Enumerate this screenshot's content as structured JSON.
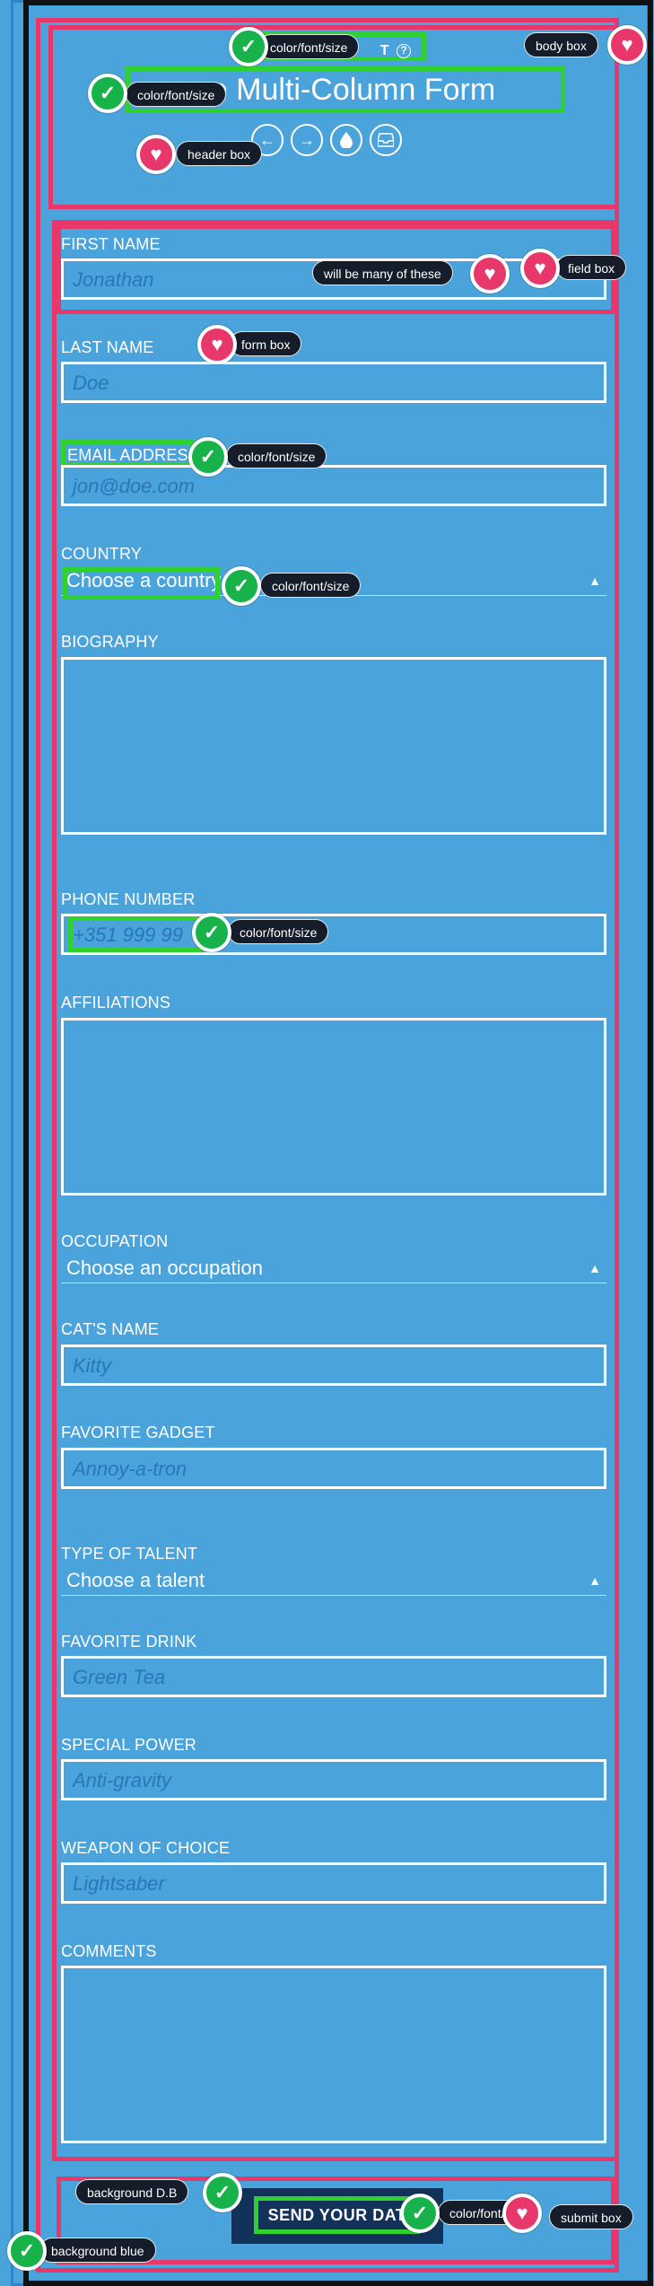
{
  "header": {
    "subtitle": "T",
    "subtitle_icon": "?",
    "title": "ve Multi-Column Form",
    "icons": [
      {
        "name": "arrow-left-icon",
        "glyph": "←"
      },
      {
        "name": "arrow-right-icon",
        "glyph": "→"
      },
      {
        "name": "drop-icon",
        "glyph": "💧"
      },
      {
        "name": "inbox-icon",
        "glyph": "✉"
      }
    ]
  },
  "form": {
    "first_name": {
      "label": "FIRST NAME",
      "placeholder": "Jonathan"
    },
    "last_name": {
      "label": "LAST NAME",
      "placeholder": "Doe"
    },
    "email": {
      "label": "EMAIL ADDRES",
      "placeholder": "jon@doe.com"
    },
    "country": {
      "label": "COUNTRY",
      "value": "Choose a country"
    },
    "biography": {
      "label": "BIOGRAPHY"
    },
    "phone": {
      "label": "PHONE NUMBER",
      "placeholder": "+351 999 99"
    },
    "affiliations": {
      "label": "AFFILIATIONS"
    },
    "occupation": {
      "label": "OCCUPATION",
      "value": "Choose an occupation"
    },
    "cats_name": {
      "label": "CAT'S NAME",
      "placeholder": "Kitty"
    },
    "favorite_gadget": {
      "label": "FAVORITE GADGET",
      "placeholder": "Annoy-a-tron"
    },
    "talent": {
      "label": "TYPE OF TALENT",
      "value": "Choose a talent"
    },
    "favorite_drink": {
      "label": "FAVORITE DRINK",
      "placeholder": "Green Tea"
    },
    "special_power": {
      "label": "SPECIAL POWER",
      "placeholder": "Anti-gravity"
    },
    "weapon": {
      "label": "WEAPON OF CHOICE",
      "placeholder": "Lightsaber"
    },
    "comments": {
      "label": "COMMENTS"
    },
    "submit_label": "SEND YOUR DAT"
  },
  "annotations": {
    "color_font_size": "color/font/size",
    "body_box": "body box",
    "header_box": "header box",
    "will_be_many": "will be many of these",
    "field_box": "field box",
    "form_box": "form box",
    "background_db": "background D.B",
    "submit_box": "submit box",
    "background_blue": "background blue"
  },
  "colors": {
    "background": "#4aa3da",
    "box_outline": "#e8386b",
    "highlight": "#2ed12e",
    "placeholder": "#2a76b8",
    "submit_background": "#12325a"
  },
  "icons": {
    "check": "check-icon",
    "heart": "heart-icon"
  }
}
